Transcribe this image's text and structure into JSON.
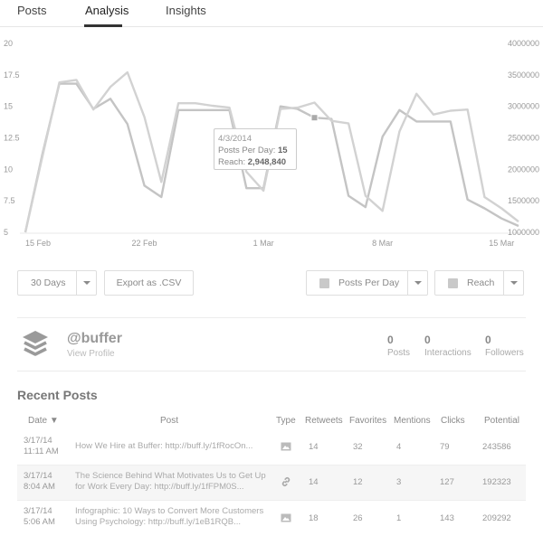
{
  "tabs": [
    {
      "label": "Posts",
      "active": false
    },
    {
      "label": "Analysis",
      "active": true
    },
    {
      "label": "Insights",
      "active": false
    }
  ],
  "chart_data": {
    "type": "line",
    "x": [
      "15 Feb",
      "16 Feb",
      "17 Feb",
      "18 Feb",
      "19 Feb",
      "20 Feb",
      "21 Feb",
      "22 Feb",
      "23 Feb",
      "24 Feb",
      "25 Feb",
      "26 Feb",
      "27 Feb",
      "28 Feb",
      "1 Mar",
      "2 Mar",
      "3 Mar",
      "4 Mar",
      "5 Mar",
      "6 Mar",
      "7 Mar",
      "8 Mar",
      "9 Mar",
      "10 Mar",
      "11 Mar",
      "12 Mar",
      "13 Mar",
      "14 Mar",
      "15 Mar",
      "16 Mar"
    ],
    "x_tick_labels": [
      "15 Feb",
      "22 Feb",
      "1 Mar",
      "8 Mar",
      "15 Mar"
    ],
    "y_left_ticks": [
      "20",
      "17.5",
      "15",
      "12.5",
      "10",
      "7.5",
      "5"
    ],
    "y_right_ticks": [
      "4000000",
      "3500000",
      "3000000",
      "2500000",
      "2000000",
      "1500000",
      "1000000"
    ],
    "ylim_left": [
      5,
      20
    ],
    "ylim_right": [
      1000000,
      4000000
    ],
    "series": [
      {
        "name": "Posts Per Day",
        "axis": "left",
        "values": [
          5,
          11.2,
          16.8,
          16.8,
          14.8,
          15.6,
          13.6,
          8.7,
          7.8,
          14.7,
          14.7,
          14.7,
          14.7,
          8.5,
          8.5,
          15,
          14.8,
          14.1,
          14,
          7.9,
          7,
          12.6,
          14.7,
          13.8,
          13.8,
          13.8,
          7.6,
          6.9,
          6.1,
          5.5
        ],
        "color": "#c4c4c4"
      },
      {
        "name": "Reach",
        "axis": "right",
        "values": [
          1000000,
          2200000,
          3380000,
          3420000,
          2950000,
          3310000,
          3540000,
          2830000,
          1800000,
          3050000,
          3050000,
          3010000,
          2980000,
          1960000,
          1660000,
          2960000,
          2980000,
          3060000,
          2770000,
          2730000,
          1580000,
          1340000,
          2600000,
          3200000,
          2870000,
          2930000,
          2950000,
          1560000,
          1380000,
          1170000
        ],
        "color": "#d2d2d2"
      }
    ],
    "tooltip": {
      "date": "4/3/2014",
      "posts_label": "Posts Per Day:",
      "posts_value": "15",
      "reach_label": "Reach:",
      "reach_value": "2,948,840",
      "index": 17
    }
  },
  "controls": {
    "range": "30 Days",
    "export": "Export as .CSV",
    "metric_left": "Posts Per Day",
    "metric_right": "Reach"
  },
  "profile": {
    "handle": "@buffer",
    "view_profile": "View Profile",
    "stats": [
      {
        "value": "0",
        "label": "Posts"
      },
      {
        "value": "0",
        "label": "Interactions"
      },
      {
        "value": "0",
        "label": "Followers"
      }
    ]
  },
  "recent": {
    "title": "Recent Posts",
    "headers": {
      "date": "Date ▼",
      "post": "Post",
      "type": "Type",
      "retweets": "Retweets",
      "favorites": "Favorites",
      "mentions": "Mentions",
      "clicks": "Clicks",
      "potential": "Potential"
    },
    "rows": [
      {
        "date": "3/17/14",
        "time": "11:11 AM",
        "post1": "How We Hire at Buffer: http://buff.ly/1fRocOn...",
        "post2": "",
        "type_icon": "image-icon",
        "retweets": "14",
        "favorites": "32",
        "mentions": "4",
        "clicks": "79",
        "potential": "243586"
      },
      {
        "date": "3/17/14",
        "time": "8:04 AM",
        "post1": "The Science Behind What Motivates Us to Get Up",
        "post2": "for Work Every Day: http://buff.ly/1fFPM0S...",
        "type_icon": "link-icon",
        "retweets": "14",
        "favorites": "12",
        "mentions": "3",
        "clicks": "127",
        "potential": "192323"
      },
      {
        "date": "3/17/14",
        "time": "5:06 AM",
        "post1": "Infographic: 10 Ways to Convert More Customers",
        "post2": "Using Psychology: http://buff.ly/1eB1RQB...",
        "type_icon": "image-icon",
        "retweets": "18",
        "favorites": "26",
        "mentions": "1",
        "clicks": "143",
        "potential": "209292"
      }
    ]
  }
}
